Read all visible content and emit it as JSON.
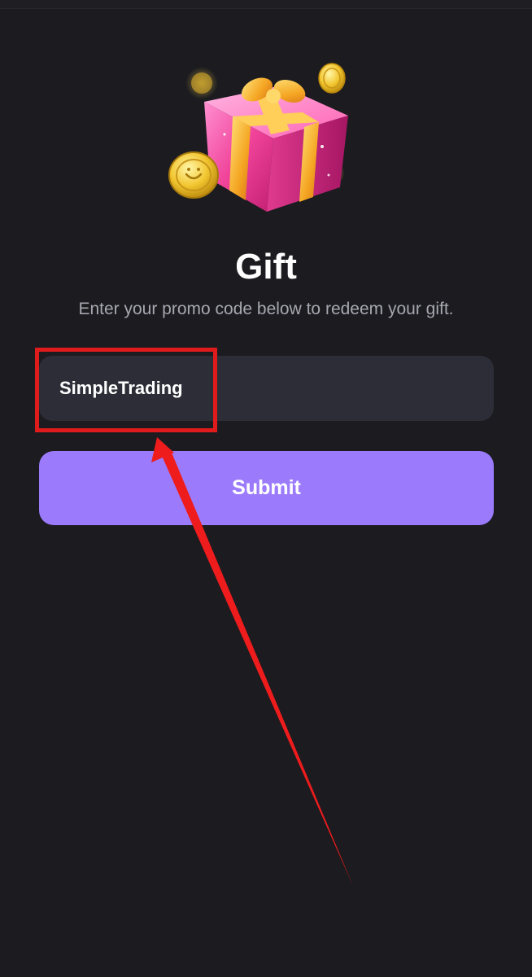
{
  "page": {
    "title": "Gift",
    "subtitle": "Enter your promo code below to redeem your gift."
  },
  "promo": {
    "value": "SimpleTrading",
    "placeholder": ""
  },
  "actions": {
    "submit_label": "Submit"
  },
  "icons": {
    "hero": "gift-box-with-coins-illustration"
  },
  "colors": {
    "background": "#1b1b20",
    "input_background": "#2c2d36",
    "accent": "#9b7bfc",
    "annotation": "#e01b1b",
    "subtitle_text": "#a7a7b0"
  }
}
